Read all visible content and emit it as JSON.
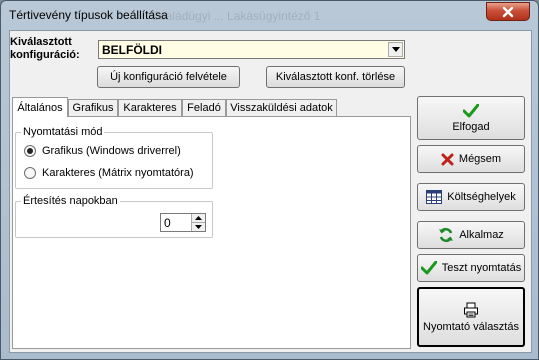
{
  "window": {
    "title": "Tértivevény típusok beállítása",
    "ghost_title": "Családügyi ... Lakásügyintéző 1"
  },
  "config": {
    "label": "Kiválasztott konfiguráció:",
    "selected": "BELFÖLDI",
    "new_button": "Új konfiguráció felvétele",
    "delete_button": "Kiválasztott konf. törlése"
  },
  "tabs": [
    "Általános",
    "Grafikus",
    "Karakteres",
    "Feladó",
    "Visszaküldési adatok"
  ],
  "print_mode": {
    "title": "Nyomtatási mód",
    "options": [
      {
        "label": "Grafikus (Windows driverrel)",
        "selected": true
      },
      {
        "label": "Karakteres (Mátrix nyomtatóra)",
        "selected": false
      }
    ]
  },
  "notify": {
    "title": "Értesítés napokban",
    "value": "0"
  },
  "actions": {
    "accept": "Elfogad",
    "cancel": "Mégsem",
    "costs": "Költséghelyek",
    "apply": "Alkalmaz",
    "test_print": "Teszt nyomtatás",
    "printer_select": "Nyomtató választás"
  },
  "colors": {
    "check_green": "#1a9a1a",
    "cancel_red": "#c0201a",
    "combo_bg": "#fffde3"
  }
}
